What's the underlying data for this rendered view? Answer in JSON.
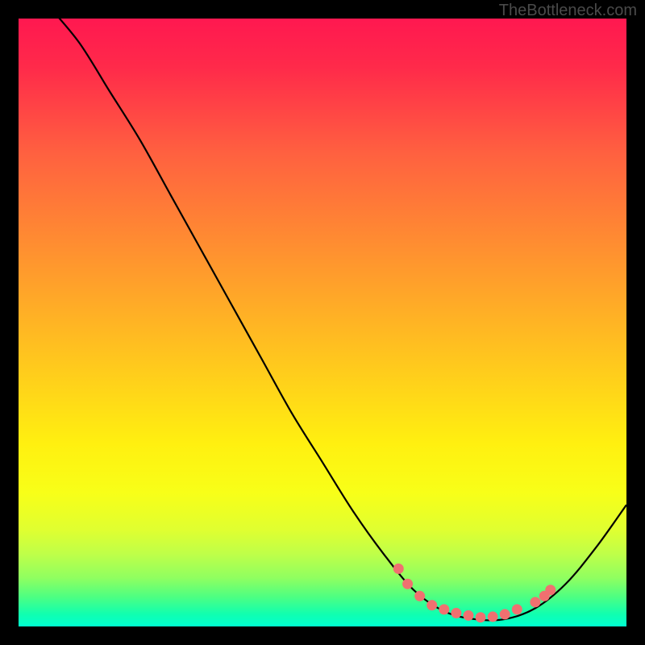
{
  "watermark": "TheBottleneck.com",
  "chart_data": {
    "type": "line",
    "title": "",
    "xlabel": "",
    "ylabel": "",
    "xlim": [
      0,
      100
    ],
    "ylim": [
      0,
      100
    ],
    "curve": {
      "name": "bottleneck-curve",
      "points_xy": [
        [
          5,
          102
        ],
        [
          10,
          96
        ],
        [
          15,
          88
        ],
        [
          20,
          80
        ],
        [
          25,
          71
        ],
        [
          30,
          62
        ],
        [
          35,
          53
        ],
        [
          40,
          44
        ],
        [
          45,
          35
        ],
        [
          50,
          27
        ],
        [
          55,
          19
        ],
        [
          60,
          12
        ],
        [
          65,
          6
        ],
        [
          70,
          2.5
        ],
        [
          75,
          1.2
        ],
        [
          80,
          1.2
        ],
        [
          85,
          3
        ],
        [
          90,
          7
        ],
        [
          95,
          13
        ],
        [
          100,
          20
        ]
      ]
    },
    "marker_cluster": {
      "name": "optimal-zone-dots",
      "points_xy": [
        [
          62.5,
          9.5
        ],
        [
          64,
          7
        ],
        [
          66,
          5
        ],
        [
          68,
          3.5
        ],
        [
          70,
          2.8
        ],
        [
          72,
          2.2
        ],
        [
          74,
          1.8
        ],
        [
          76,
          1.5
        ],
        [
          78,
          1.6
        ],
        [
          80,
          2
        ],
        [
          82,
          2.8
        ],
        [
          85,
          4
        ],
        [
          86.5,
          5
        ],
        [
          87.5,
          6
        ]
      ]
    },
    "colors": {
      "curve_stroke": "#000000",
      "dot_fill": "#f07070",
      "gradient_top": "#ff1850",
      "gradient_bottom": "#00ffd0",
      "frame": "#000000"
    }
  }
}
